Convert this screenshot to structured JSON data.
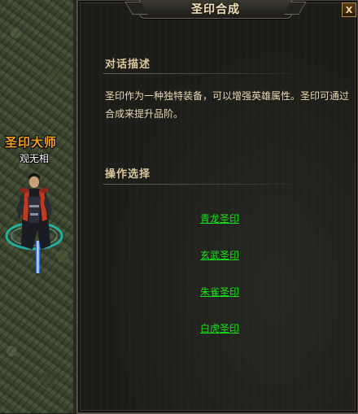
{
  "npc": {
    "title": "圣印大师",
    "name": "观无相"
  },
  "dialog": {
    "title": "圣印合成",
    "close_label": "X",
    "description_heading": "对话描述",
    "description_text": "圣印作为一种独特装备，可以增强英雄属性。圣印可通过合成来提升品阶。",
    "options_heading": "操作选择",
    "options": [
      {
        "label": "青龙圣印"
      },
      {
        "label": "玄武圣印"
      },
      {
        "label": "朱雀圣印"
      },
      {
        "label": "白虎圣印"
      }
    ]
  },
  "colors": {
    "npc_title": "#f1a21a",
    "option_link": "#14e614",
    "heading": "#dcc99b",
    "body_text": "#e7d9b5"
  }
}
